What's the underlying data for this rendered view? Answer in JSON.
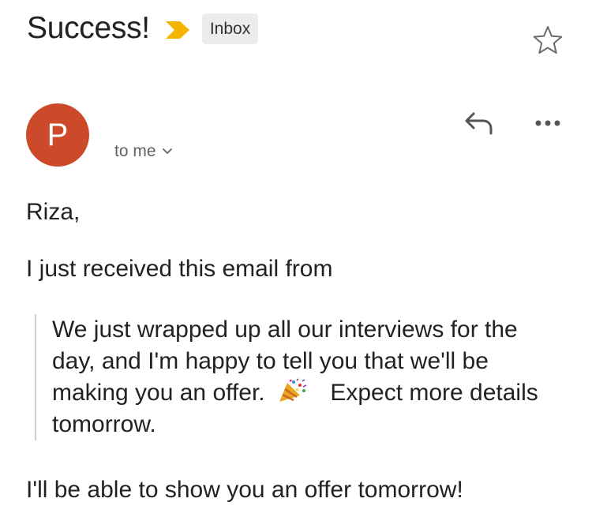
{
  "email": {
    "subject": "Success!",
    "label": "Inbox",
    "sender_initial": "P",
    "recipient_text": "to me",
    "avatar_color": "#cc4a2a",
    "importance_color": "#f4b400"
  },
  "body": {
    "greeting": "Riza,",
    "intro": "I just received this email from",
    "quote_part1": "We just wrapped up all our interviews for the day, and I'm happy to tell you that we'll be making you an offer.",
    "quote_emoji": "party-popper",
    "quote_part2": "Expect more details tomorrow.",
    "closing": "I'll be able to show you an offer tomorrow!"
  },
  "icons": {
    "importance": "importance-marker-icon",
    "star": "star-icon",
    "reply": "reply-icon",
    "more": "more-options-icon",
    "chevron": "chevron-down-icon"
  }
}
